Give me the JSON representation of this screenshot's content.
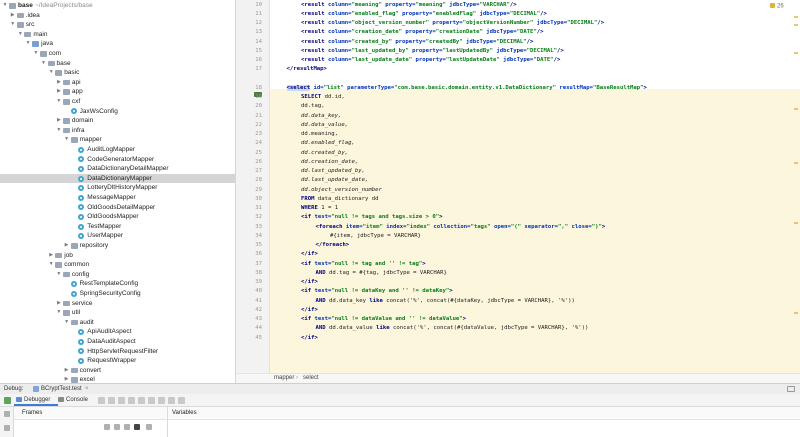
{
  "tree": {
    "rows": [
      {
        "label": "base",
        "dim": "~/IdeaProjects/base",
        "bold": true,
        "depth": 0,
        "icon": "folder",
        "open": true
      },
      {
        "label": ".idea",
        "depth": 1,
        "icon": "folder",
        "open": false
      },
      {
        "label": "src",
        "depth": 1,
        "icon": "folder",
        "open": true
      },
      {
        "label": "main",
        "depth": 2,
        "icon": "folder",
        "open": true
      },
      {
        "label": "java",
        "depth": 3,
        "icon": "folder-src",
        "open": true
      },
      {
        "label": "com",
        "depth": 4,
        "icon": "folder",
        "open": true
      },
      {
        "label": "base",
        "depth": 5,
        "icon": "folder",
        "open": true
      },
      {
        "label": "basic",
        "depth": 6,
        "icon": "folder",
        "open": true
      },
      {
        "label": "api",
        "depth": 7,
        "icon": "folder",
        "open": false
      },
      {
        "label": "app",
        "depth": 7,
        "icon": "folder",
        "open": false
      },
      {
        "label": "cxf",
        "depth": 7,
        "icon": "folder",
        "open": true
      },
      {
        "label": "JaxWsConfig",
        "depth": 8,
        "icon": "file"
      },
      {
        "label": "domain",
        "depth": 7,
        "icon": "folder",
        "open": false
      },
      {
        "label": "infra",
        "depth": 7,
        "icon": "folder",
        "open": true
      },
      {
        "label": "mapper",
        "depth": 8,
        "icon": "folder",
        "open": true
      },
      {
        "label": "AuditLogMapper",
        "depth": 9,
        "icon": "file"
      },
      {
        "label": "CodeGeneratorMapper",
        "depth": 9,
        "icon": "file"
      },
      {
        "label": "DataDictionaryDetailMapper",
        "depth": 9,
        "icon": "file"
      },
      {
        "label": "DataDictionaryMapper",
        "depth": 9,
        "icon": "file",
        "selected": true
      },
      {
        "label": "LotteryDltHistoryMapper",
        "depth": 9,
        "icon": "file"
      },
      {
        "label": "MessageMapper",
        "depth": 9,
        "icon": "file"
      },
      {
        "label": "OldGoodsDetailMapper",
        "depth": 9,
        "icon": "file"
      },
      {
        "label": "OldGoodsMapper",
        "depth": 9,
        "icon": "file"
      },
      {
        "label": "TestMapper",
        "depth": 9,
        "icon": "file"
      },
      {
        "label": "UserMapper",
        "depth": 9,
        "icon": "file"
      },
      {
        "label": "repository",
        "depth": 8,
        "icon": "folder",
        "open": false
      },
      {
        "label": "job",
        "depth": 6,
        "icon": "folder",
        "open": false
      },
      {
        "label": "common",
        "depth": 6,
        "icon": "folder",
        "open": true
      },
      {
        "label": "config",
        "depth": 7,
        "icon": "folder",
        "open": true
      },
      {
        "label": "RestTemplateConfig",
        "depth": 8,
        "icon": "file"
      },
      {
        "label": "SpringSecurityConfig",
        "depth": 8,
        "icon": "file"
      },
      {
        "label": "service",
        "depth": 7,
        "icon": "folder",
        "open": false
      },
      {
        "label": "util",
        "depth": 7,
        "icon": "folder",
        "open": true
      },
      {
        "label": "audit",
        "depth": 8,
        "icon": "folder",
        "open": true
      },
      {
        "label": "ApiAuditAspect",
        "depth": 9,
        "icon": "file"
      },
      {
        "label": "DataAuditAspect",
        "depth": 9,
        "icon": "file"
      },
      {
        "label": "HttpServletRequestFilter",
        "depth": 9,
        "icon": "file"
      },
      {
        "label": "RequestWrapper",
        "depth": 9,
        "icon": "file"
      },
      {
        "label": "convert",
        "depth": 8,
        "icon": "folder",
        "open": false
      },
      {
        "label": "excel",
        "depth": 8,
        "icon": "folder",
        "open": false
      },
      {
        "label": "http",
        "depth": 8,
        "icon": "folder",
        "open": false
      }
    ]
  },
  "editor": {
    "warning_count": "26",
    "lines": [
      {
        "n": "10",
        "indent": 2,
        "segs": [
          [
            "tg",
            "<result "
          ],
          [
            "at",
            "column="
          ],
          [
            "av",
            "\"meaning\" "
          ],
          [
            "at",
            "property="
          ],
          [
            "av",
            "\"meaning\" "
          ],
          [
            "at",
            "jdbcType="
          ],
          [
            "av",
            "\"VARCHAR\""
          ],
          [
            "tg",
            "/>"
          ]
        ]
      },
      {
        "n": "11",
        "indent": 2,
        "segs": [
          [
            "tg",
            "<result "
          ],
          [
            "at",
            "column="
          ],
          [
            "av",
            "\"enabled_flag\" "
          ],
          [
            "at",
            "property="
          ],
          [
            "av",
            "\"enabledFlag\" "
          ],
          [
            "at",
            "jdbcType="
          ],
          [
            "av",
            "\"DECIMAL\""
          ],
          [
            "tg",
            "/>"
          ]
        ]
      },
      {
        "n": "12",
        "indent": 2,
        "segs": [
          [
            "tg",
            "<result "
          ],
          [
            "at",
            "column="
          ],
          [
            "av",
            "\"object_version_number\" "
          ],
          [
            "at",
            "property="
          ],
          [
            "av",
            "\"objectVersionNumber\" "
          ],
          [
            "at",
            "jdbcType="
          ],
          [
            "av",
            "\"DECIMAL\""
          ],
          [
            "tg",
            "/>"
          ]
        ]
      },
      {
        "n": "13",
        "indent": 2,
        "segs": [
          [
            "tg",
            "<result "
          ],
          [
            "at",
            "column="
          ],
          [
            "av",
            "\"creation_date\" "
          ],
          [
            "at",
            "property="
          ],
          [
            "av",
            "\"creationDate\" "
          ],
          [
            "at",
            "jdbcType="
          ],
          [
            "av",
            "\"DATE\""
          ],
          [
            "tg",
            "/>"
          ]
        ]
      },
      {
        "n": "14",
        "indent": 2,
        "segs": [
          [
            "tg",
            "<result "
          ],
          [
            "at",
            "column="
          ],
          [
            "av",
            "\"created_by\" "
          ],
          [
            "at",
            "property="
          ],
          [
            "av",
            "\"createdBy\" "
          ],
          [
            "at",
            "jdbcType="
          ],
          [
            "av",
            "\"DECIMAL\""
          ],
          [
            "tg",
            "/>"
          ]
        ]
      },
      {
        "n": "15",
        "indent": 2,
        "segs": [
          [
            "tg",
            "<result "
          ],
          [
            "at",
            "column="
          ],
          [
            "av",
            "\"last_updated_by\" "
          ],
          [
            "at",
            "property="
          ],
          [
            "av",
            "\"lastUpdatedBy\" "
          ],
          [
            "at",
            "jdbcType="
          ],
          [
            "av",
            "\"DECIMAL\""
          ],
          [
            "tg",
            "/>"
          ]
        ]
      },
      {
        "n": "16",
        "indent": 2,
        "segs": [
          [
            "tg",
            "<result "
          ],
          [
            "at",
            "column="
          ],
          [
            "av",
            "\"last_update_date\" "
          ],
          [
            "at",
            "property="
          ],
          [
            "av",
            "\"lastUpdateDate\" "
          ],
          [
            "at",
            "jdbcType="
          ],
          [
            "av",
            "\"DATE\""
          ],
          [
            "tg",
            "/>"
          ]
        ]
      },
      {
        "n": "17",
        "indent": 1,
        "segs": [
          [
            "tg",
            "</resultMap>"
          ]
        ]
      },
      {
        "n": "",
        "indent": 0,
        "segs": []
      },
      {
        "n": "18",
        "indent": 1,
        "segs": [
          [
            "tgsel",
            "<select"
          ],
          [
            "tg",
            " "
          ],
          [
            "at",
            "id="
          ],
          [
            "av",
            "\"list\" "
          ],
          [
            "at",
            "parameterType="
          ],
          [
            "av",
            "\"com.base.basic.domain.entity.v1.DataDictionary\" "
          ],
          [
            "at",
            "resultMap="
          ],
          [
            "av",
            "\"BaseResultMap\""
          ],
          [
            "tg",
            ">"
          ]
        ]
      },
      {
        "n": "19",
        "indent": 2,
        "segs": [
          [
            "kw",
            "SELECT "
          ],
          [
            "fn",
            "dd.id,"
          ]
        ]
      },
      {
        "n": "20",
        "indent": 2,
        "segs": [
          [
            "fn",
            "dd.tag,"
          ]
        ]
      },
      {
        "n": "21",
        "indent": 2,
        "segs": [
          [
            "it",
            "dd.data_key,"
          ]
        ]
      },
      {
        "n": "22",
        "indent": 2,
        "segs": [
          [
            "it",
            "dd.data_value,"
          ]
        ]
      },
      {
        "n": "23",
        "indent": 2,
        "segs": [
          [
            "fn",
            "dd.meaning,"
          ]
        ]
      },
      {
        "n": "24",
        "indent": 2,
        "segs": [
          [
            "it",
            "dd.enabled_flag,"
          ]
        ]
      },
      {
        "n": "25",
        "indent": 2,
        "segs": [
          [
            "it",
            "dd.created_by,"
          ]
        ]
      },
      {
        "n": "26",
        "indent": 2,
        "segs": [
          [
            "it",
            "dd.creation_date,"
          ]
        ]
      },
      {
        "n": "27",
        "indent": 2,
        "segs": [
          [
            "it",
            "dd.last_updated_by,"
          ]
        ]
      },
      {
        "n": "28",
        "indent": 2,
        "segs": [
          [
            "it",
            "dd.last_update_date,"
          ]
        ]
      },
      {
        "n": "29",
        "indent": 2,
        "segs": [
          [
            "it",
            "dd.object_version_number"
          ]
        ]
      },
      {
        "n": "30",
        "indent": 2,
        "segs": [
          [
            "kw",
            "FROM "
          ],
          [
            "fn",
            "data_dictionary dd"
          ]
        ]
      },
      {
        "n": "31",
        "indent": 2,
        "segs": [
          [
            "kw",
            "WHERE "
          ],
          [
            "fn",
            "1 = 1"
          ]
        ]
      },
      {
        "n": "32",
        "indent": 2,
        "segs": [
          [
            "tg",
            "<if "
          ],
          [
            "at",
            "test="
          ],
          [
            "av",
            "\"null != tags and tags.size > 0\""
          ],
          [
            "tg",
            ">"
          ]
        ]
      },
      {
        "n": "33",
        "indent": 3,
        "segs": [
          [
            "tg",
            "<foreach "
          ],
          [
            "at",
            "item="
          ],
          [
            "av",
            "\"item\" "
          ],
          [
            "at",
            "index="
          ],
          [
            "av",
            "\"index\" "
          ],
          [
            "at",
            "collection="
          ],
          [
            "av",
            "\"tags\" "
          ],
          [
            "at",
            "open="
          ],
          [
            "av",
            "\"(\" "
          ],
          [
            "at",
            "separator="
          ],
          [
            "av",
            "\",\" "
          ],
          [
            "at",
            "close="
          ],
          [
            "av",
            "\")\""
          ],
          [
            "tg",
            ">"
          ]
        ]
      },
      {
        "n": "34",
        "indent": 4,
        "segs": [
          [
            "fn",
            "#{item, jdbcType = VARCHAR}"
          ]
        ]
      },
      {
        "n": "35",
        "indent": 3,
        "segs": [
          [
            "tg",
            "</foreach>"
          ]
        ]
      },
      {
        "n": "36",
        "indent": 2,
        "segs": [
          [
            "tg",
            "</if>"
          ]
        ]
      },
      {
        "n": "37",
        "indent": 2,
        "segs": [
          [
            "tg",
            "<if "
          ],
          [
            "at",
            "test="
          ],
          [
            "av",
            "\"null != tag and '' != tag\""
          ],
          [
            "tg",
            ">"
          ]
        ]
      },
      {
        "n": "38",
        "indent": 3,
        "segs": [
          [
            "kw",
            "AND "
          ],
          [
            "fn",
            "dd.tag = #{tag, jdbcType = VARCHAR}"
          ]
        ]
      },
      {
        "n": "39",
        "indent": 2,
        "segs": [
          [
            "tg",
            "</if>"
          ]
        ]
      },
      {
        "n": "40",
        "indent": 2,
        "segs": [
          [
            "tg",
            "<if "
          ],
          [
            "at",
            "test="
          ],
          [
            "av",
            "\"null != dataKey and '' != dataKey\""
          ],
          [
            "tg",
            ">"
          ]
        ]
      },
      {
        "n": "41",
        "indent": 3,
        "segs": [
          [
            "kw",
            "AND "
          ],
          [
            "fn",
            "dd.data_key "
          ],
          [
            "kw",
            "like "
          ],
          [
            "fn",
            "concat('%', concat(#{dataKey, jdbcType = VARCHAR}, '%'))"
          ]
        ]
      },
      {
        "n": "42",
        "indent": 2,
        "segs": [
          [
            "tg",
            "</if>"
          ]
        ]
      },
      {
        "n": "43",
        "indent": 2,
        "segs": [
          [
            "tg",
            "<if "
          ],
          [
            "at",
            "test="
          ],
          [
            "av",
            "\"null != dataValue and '' != dataValue\""
          ],
          [
            "tg",
            ">"
          ]
        ]
      },
      {
        "n": "44",
        "indent": 3,
        "segs": [
          [
            "kw",
            "AND "
          ],
          [
            "fn",
            "dd.data_value "
          ],
          [
            "kw",
            "like "
          ],
          [
            "fn",
            "concat('%', concat(#{dataValue, jdbcType = VARCHAR}, '%'))"
          ]
        ]
      },
      {
        "n": "45",
        "indent": 2,
        "segs": [
          [
            "tg",
            "</if>"
          ]
        ]
      }
    ]
  },
  "breadcrumb": [
    "mapper",
    "select"
  ],
  "debug": {
    "title": "Debug:",
    "session": "BCryptTest.test",
    "close_glyph": "×",
    "tabs": [
      "Debugger",
      "Console"
    ],
    "frames_label": "Frames",
    "variables_label": "Variables"
  }
}
